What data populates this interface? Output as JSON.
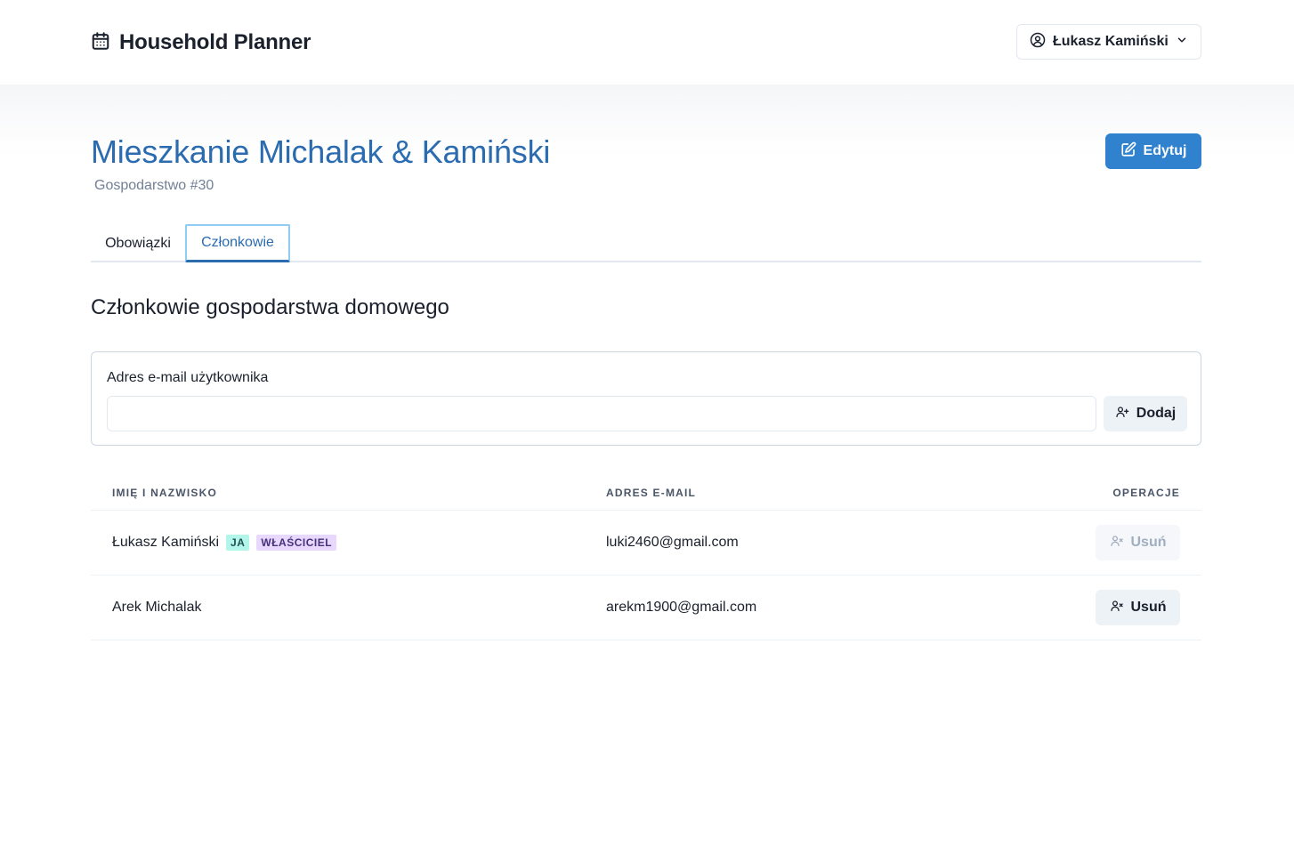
{
  "header": {
    "app_title": "Household Planner",
    "brand_icon": "calendar-icon",
    "user_name": "Łukasz Kamiński"
  },
  "page": {
    "title": "Mieszkanie Michalak & Kamiński",
    "subtitle": "Gospodarstwo #30",
    "edit_label": "Edytuj"
  },
  "tabs": [
    {
      "label": "Obowiązki",
      "active": false
    },
    {
      "label": "Członkowie",
      "active": true
    }
  ],
  "members_section": {
    "title": "Członkowie gospodarstwa domowego",
    "email_label": "Adres e-mail użytkownika",
    "email_value": "",
    "add_label": "Dodaj"
  },
  "table": {
    "headers": {
      "name": "IMIĘ I NAZWISKO",
      "email": "ADRES E-MAIL",
      "ops": "OPERACJE"
    },
    "rows": [
      {
        "name": "Łukasz Kamiński",
        "badges": [
          "JA",
          "WŁAŚCICIEL"
        ],
        "email": "luki2460@gmail.com",
        "remove_label": "Usuń",
        "remove_enabled": false
      },
      {
        "name": "Arek Michalak",
        "badges": [],
        "email": "arekm1900@gmail.com",
        "remove_label": "Usuń",
        "remove_enabled": true
      }
    ]
  },
  "colors": {
    "primary": "#3182ce",
    "title": "#2b6cb0",
    "badge_me_bg": "#b2f5ea",
    "badge_owner_bg": "#e9d8fd"
  }
}
